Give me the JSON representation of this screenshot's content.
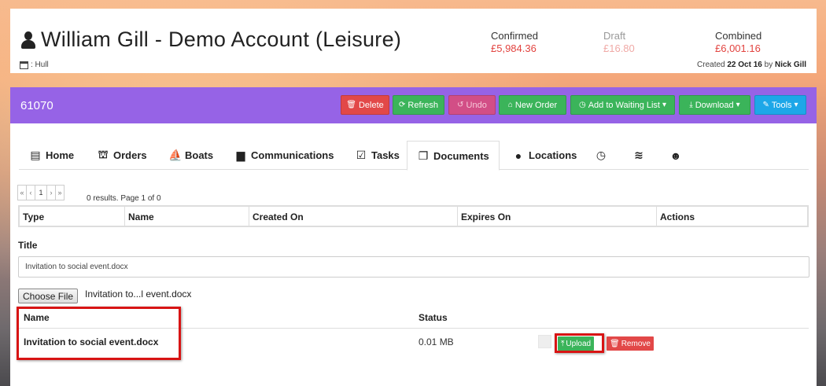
{
  "account": {
    "title": "William Gill - Demo Account (Leisure)",
    "location": ": Hull",
    "created_prefix": "Created",
    "created_date": "22 Oct 16",
    "created_by_prefix": "by",
    "created_by": "Nick Gill"
  },
  "stats": [
    {
      "label": "Confirmed",
      "value": "£5,984.36"
    },
    {
      "label": "Draft",
      "value": "£16.80"
    },
    {
      "label": "Combined",
      "value": "£6,001.16"
    }
  ],
  "toolbar": {
    "id": "61070",
    "delete": "Delete",
    "refresh": "Refresh",
    "undo": "Undo",
    "new_order": "New Order",
    "waiting_list": "Add to Waiting List",
    "download": "Download",
    "tools": "Tools"
  },
  "tabs": [
    "Home",
    "Orders",
    "Boats",
    "Communications",
    "Tasks",
    "Documents",
    "Locations"
  ],
  "active_tab": "Documents",
  "pager": {
    "first": "«",
    "prev": "‹",
    "page": "1",
    "next": "›",
    "last": "»",
    "results": "0 results. Page 1 of 0"
  },
  "documents_table": {
    "columns": [
      "Type",
      "Name",
      "Created On",
      "Expires On",
      "Actions"
    ]
  },
  "form": {
    "title_label": "Title",
    "title_value": "Invitation to social event.docx",
    "choose_file": "Choose File",
    "selected_file": "Invitation to...l event.docx"
  },
  "upload_table": {
    "columns": [
      "Name",
      "Status"
    ],
    "rows": [
      {
        "name": "Invitation to social event.docx",
        "status": "0.01 MB"
      }
    ],
    "upload": "Upload",
    "remove": "Remove"
  },
  "colors": {
    "toolbar": "#9663e6",
    "danger": "#e24848",
    "success": "#3bb45a",
    "highlight": "#d81414"
  }
}
